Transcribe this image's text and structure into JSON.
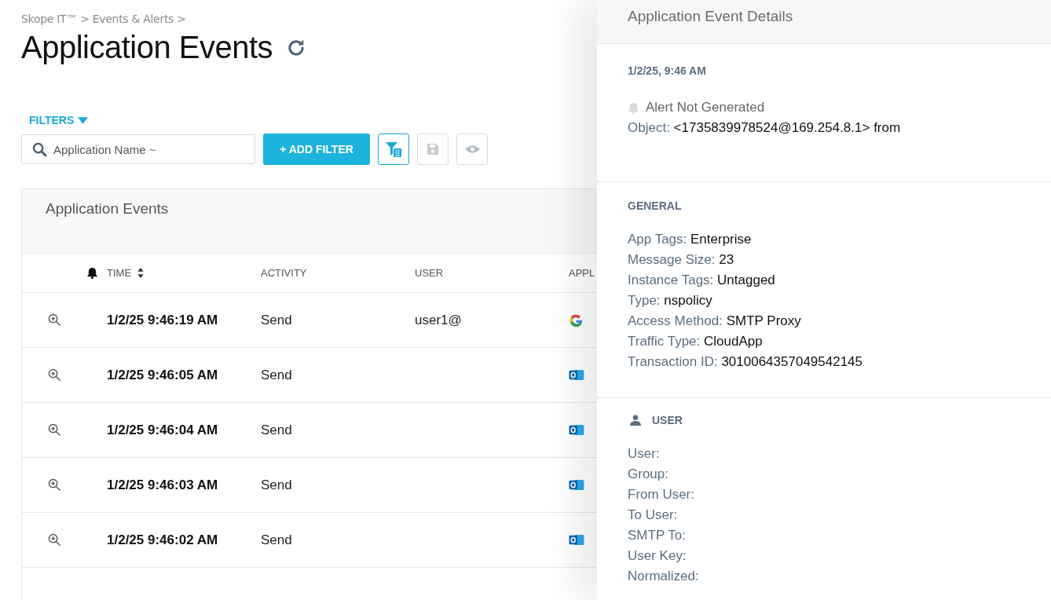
{
  "breadcrumb": "Skope IT™ > Events & Alerts >",
  "page_title": "Application Events",
  "filters": {
    "label": "FILTERS",
    "search_placeholder": "Application Name ~",
    "add_button": "+ ADD FILTER"
  },
  "table": {
    "title": "Application Events",
    "columns": [
      {
        "label": "TIME",
        "sortable": true
      },
      {
        "label": "ACTIVITY",
        "sortable": false
      },
      {
        "label": "USER",
        "sortable": false
      },
      {
        "label": "APPL",
        "sortable": false
      }
    ],
    "rows": [
      {
        "time": "1/2/25 9:46:19 AM",
        "activity": "Send",
        "user": "user1@",
        "kind": "google"
      },
      {
        "time": "1/2/25 9:46:05 AM",
        "activity": "Send",
        "user": "",
        "kind": "outlook"
      },
      {
        "time": "1/2/25 9:46:04 AM",
        "activity": "Send",
        "user": "",
        "kind": "outlook"
      },
      {
        "time": "1/2/25 9:46:03 AM",
        "activity": "Send",
        "user": "",
        "kind": "outlook"
      },
      {
        "time": "1/2/25 9:46:02 AM",
        "activity": "Send",
        "user": "",
        "kind": "outlook"
      }
    ]
  },
  "details": {
    "title": "Application Event Details",
    "timestamp": "1/2/25, 9:46 AM",
    "alert": "Alert Not Generated",
    "object": {
      "label": "Object:",
      "value": "<1735839978524@169.254.8.1> from"
    },
    "general": {
      "heading": "GENERAL",
      "fields": [
        {
          "label": "App Tags:",
          "value": "Enterprise"
        },
        {
          "label": "Message Size:",
          "value": "23"
        },
        {
          "label": "Instance Tags:",
          "value": "Untagged"
        },
        {
          "label": "Type:",
          "value": "nspolicy"
        },
        {
          "label": "Access Method:",
          "value": "SMTP Proxy"
        },
        {
          "label": "Traffic Type:",
          "value": "CloudApp"
        },
        {
          "label": "Transaction ID:",
          "value": "3010064357049542145"
        }
      ]
    },
    "user": {
      "heading": "USER",
      "fields": [
        {
          "label": "User:"
        },
        {
          "label": "Group:"
        },
        {
          "label": "From User:"
        },
        {
          "label": "To User:"
        },
        {
          "label": "SMTP To:"
        },
        {
          "label": "User Key:"
        },
        {
          "label": "Normalized:"
        }
      ]
    }
  }
}
